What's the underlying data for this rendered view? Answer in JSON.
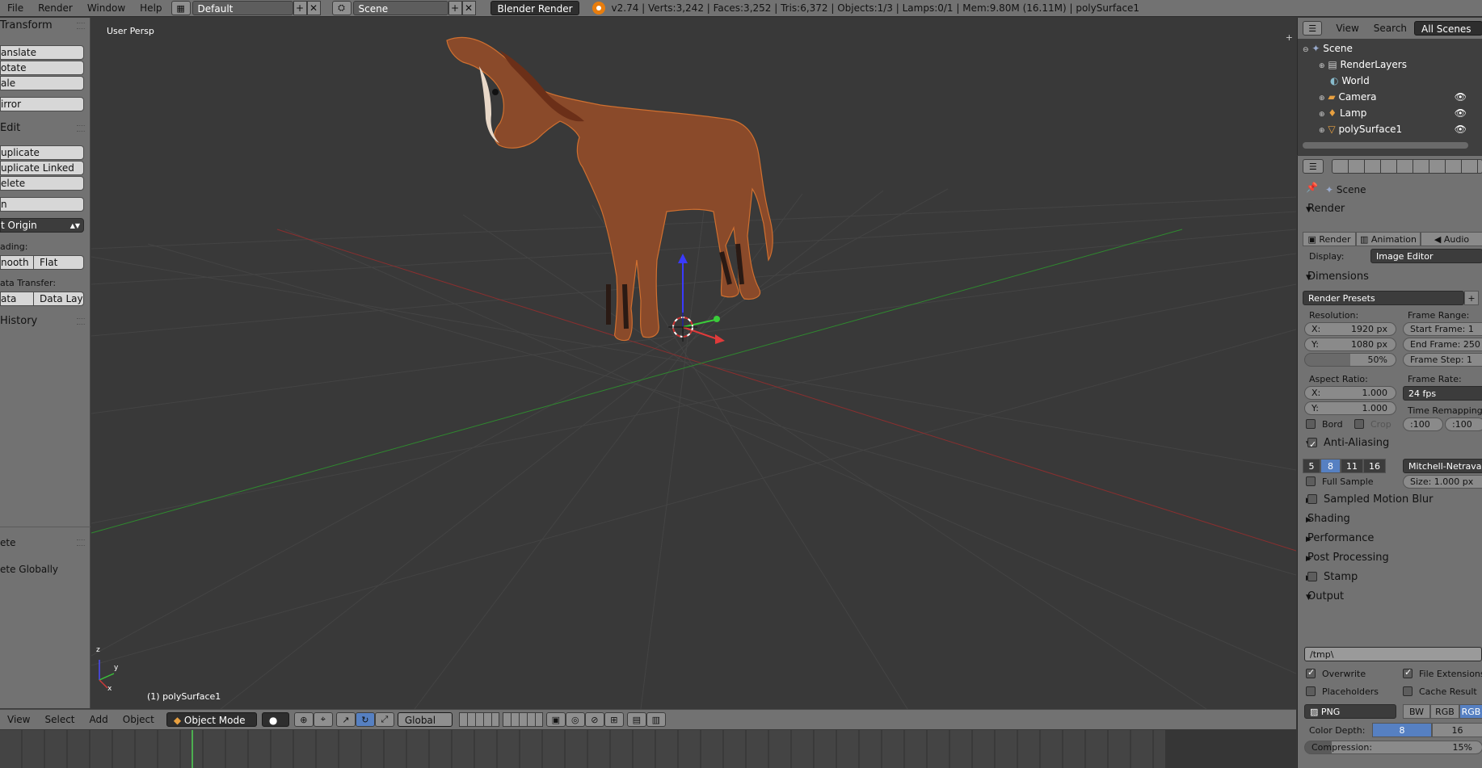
{
  "topbar": {
    "menus": [
      "File",
      "Render",
      "Window",
      "Help"
    ],
    "layout": "Default",
    "scene": "Scene",
    "engine": "Blender Render",
    "stats": "v2.74 | Verts:3,242 | Faces:3,252 | Tris:6,372 | Objects:1/3 | Lamps:0/1 | Mem:9.80M (16.11M) | polySurface1"
  },
  "toolshelf": {
    "transform_header": "Transform",
    "translate": "anslate",
    "rotate": "otate",
    "scale": "ale",
    "mirror": "irror",
    "edit_header": "Edit",
    "duplicate": "uplicate",
    "duplicate_linked": "uplicate Linked",
    "delete": "elete",
    "join": "n",
    "set_origin": "t Origin",
    "shading_label": "ading:",
    "smooth": "nooth",
    "flat": "Flat",
    "data_transfer_label": "ata Transfer:",
    "data": "ata",
    "data_layout": "Data Layo",
    "history_header": "History",
    "operator_header": "ete",
    "delete_globally": "ete Globally"
  },
  "viewport": {
    "view_name": "User Persp",
    "object_label": "(1) polySurface1",
    "axis_labels": {
      "z": "z",
      "y": "y",
      "x": "x"
    }
  },
  "v3d_header": {
    "menus": [
      "View",
      "Select",
      "Add",
      "Object"
    ],
    "mode": "Object Mode",
    "orientation": "Global"
  },
  "outliner": {
    "header_menus": [
      "View",
      "Search"
    ],
    "filter": "All Scenes",
    "rows": [
      "Scene",
      "RenderLayers",
      "World",
      "Camera",
      "Lamp",
      "polySurface1"
    ]
  },
  "properties": {
    "context": "Scene",
    "render_header": "Render",
    "render_btn": "Render",
    "animation_btn": "Animation",
    "audio_btn": "Audio",
    "display_label": "Display:",
    "display_value": "Image Editor",
    "dimensions_header": "Dimensions",
    "render_presets": "Render Presets",
    "resolution_label": "Resolution:",
    "res_x_label": "X:",
    "res_x": "1920 px",
    "res_y_label": "Y:",
    "res_y": "1080 px",
    "res_pct": "50%",
    "frame_range_label": "Frame Range:",
    "start_frame_label": "Start Frame:",
    "start_frame": "1",
    "end_frame_label": "End Frame:",
    "end_frame": "250",
    "frame_step_label": "Frame Step:",
    "frame_step": "1",
    "aspect_label": "Aspect Ratio:",
    "aspect_x": "1.000",
    "aspect_y": "1.000",
    "frame_rate_label": "Frame Rate:",
    "frame_rate": "24 fps",
    "border_label": "Bord",
    "crop_label": "Crop",
    "time_remap_label": "Time Remapping:",
    "remap_old": ":100",
    "remap_new": ":100",
    "aa_header": "Anti-Aliasing",
    "aa_samples": [
      "5",
      "8",
      "11",
      "16"
    ],
    "aa_filter": "Mitchell-Netravali",
    "full_sample": "Full Sample",
    "aa_size_label": "Size:",
    "aa_size": "1.000 px",
    "motion_blur_header": "Sampled Motion Blur",
    "shading_header": "Shading",
    "performance_header": "Performance",
    "post_processing_header": "Post Processing",
    "stamp_header": "Stamp",
    "output_header": "Output",
    "output_path": "/tmp\\",
    "overwrite": "Overwrite",
    "file_extensions": "File Extensions",
    "placeholders": "Placeholders",
    "cache_result": "Cache Result",
    "file_format": "PNG",
    "color_modes": [
      "BW",
      "RGB",
      "RGB"
    ],
    "color_depth_label": "Color Depth:",
    "color_depths": [
      "8",
      "16"
    ],
    "compression_label": "Compression:",
    "compression": "15%"
  }
}
